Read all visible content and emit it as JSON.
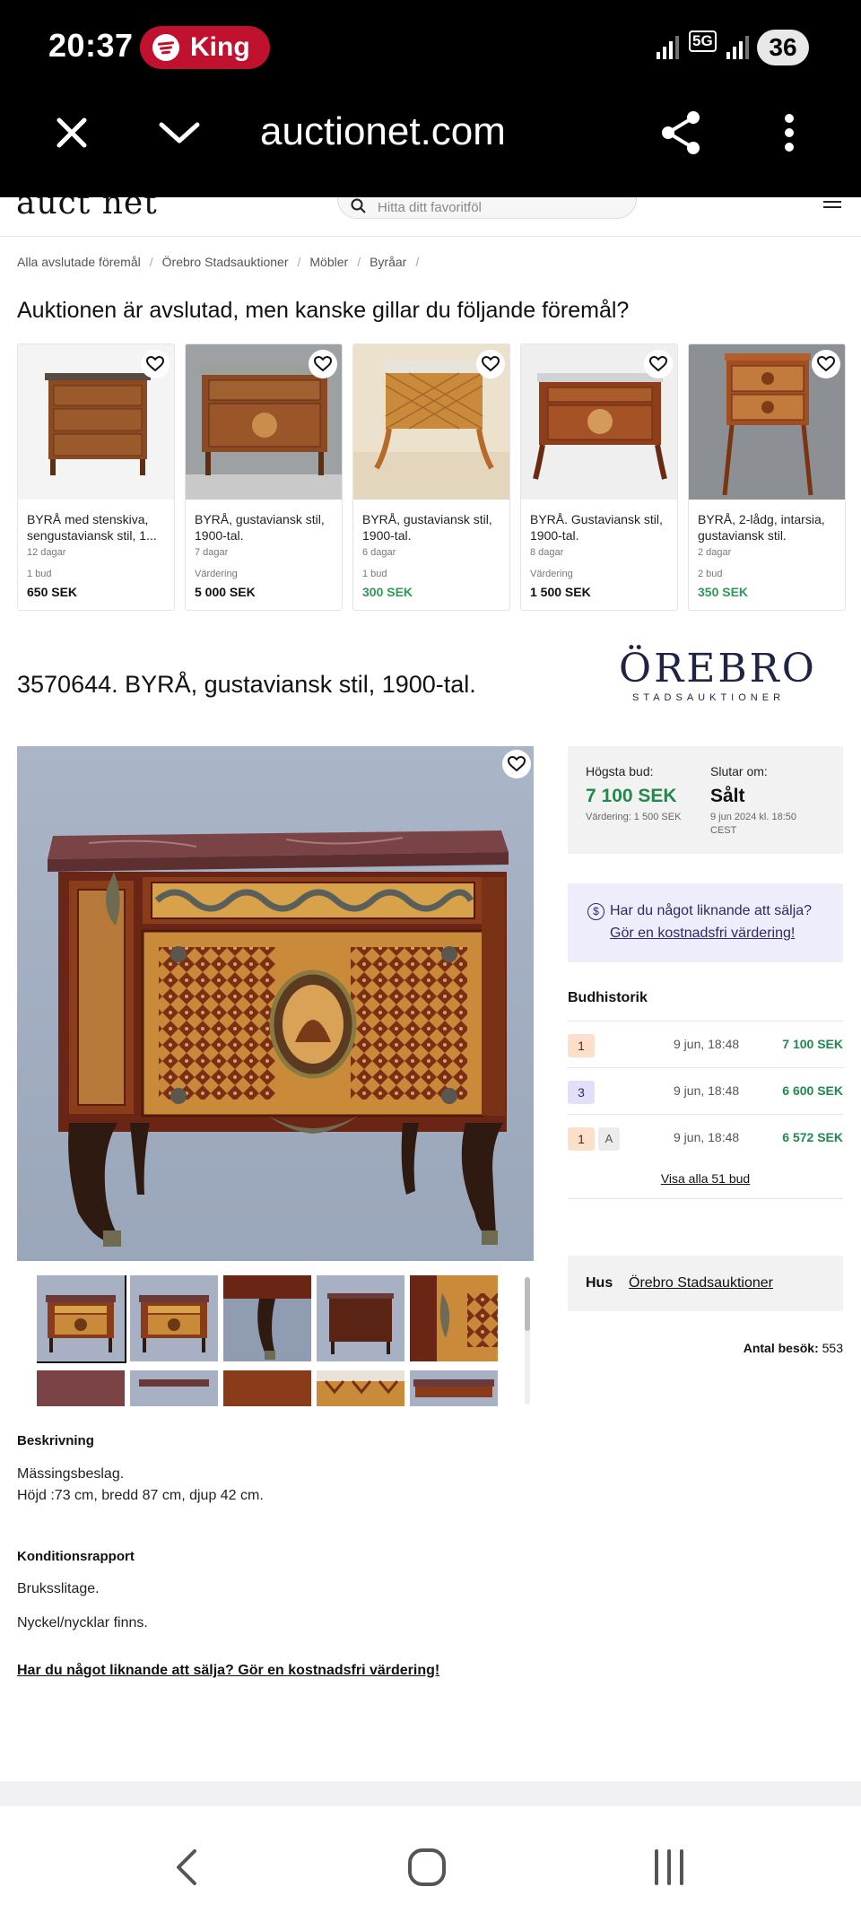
{
  "status": {
    "time": "20:37",
    "media_app": "King",
    "network": "5G",
    "battery": "36"
  },
  "browser": {
    "url": "auctionet.com",
    "icons": [
      "close-icon",
      "chevron-down-icon",
      "share-icon",
      "more-vertical-icon"
    ]
  },
  "site_header": {
    "logo": "auct  net",
    "search_placeholder": "Hitta ditt favoritföl"
  },
  "breadcrumb": [
    "Alla avslutade föremål",
    "Örebro Stadsauktioner",
    "Möbler",
    "Byråar"
  ],
  "recommendations": {
    "heading": "Auktionen är avslutad, men kanske gillar du följande föremål?",
    "items": [
      {
        "title": "BYRÅ med stenskiva, sengustaviansk stil, 1...",
        "time": "12 dagar",
        "meta": "1 bud",
        "price": "650 SEK",
        "price_color": "#111111"
      },
      {
        "title": "BYRÅ, gustaviansk stil, 1900-tal.",
        "time": "7 dagar",
        "meta": "Värdering",
        "price": "5 000 SEK",
        "price_color": "#111111"
      },
      {
        "title": "BYRÅ, gustaviansk stil, 1900-tal.",
        "time": "6 dagar",
        "meta": "1 bud",
        "price": "300 SEK",
        "price_color": "#2a9d55"
      },
      {
        "title": "BYRÅ. Gustaviansk stil, 1900-tal.",
        "time": "8 dagar",
        "meta": "Värdering",
        "price": "1 500 SEK",
        "price_color": "#111111"
      },
      {
        "title": "BYRÅ, 2-lådg, intarsia, gustaviansk stil.",
        "time": "2 dagar",
        "meta": "2 bud",
        "price": "350 SEK",
        "price_color": "#2a9d55"
      }
    ]
  },
  "lot": {
    "title": "3570644. BYRÅ, gustaviansk stil, 1900-tal.",
    "house_logo_main": "ÖREBRO",
    "house_logo_sub": "STADSAUKTIONER"
  },
  "bid_summary": {
    "highest_label": "Högsta bud:",
    "highest_value": "7 100 SEK",
    "valuation": "Värdering: 1 500 SEK",
    "ends_label": "Slutar om:",
    "ends_value": "Sålt",
    "ends_date": "9 jun 2024 kl. 18:50",
    "ends_tz": "CEST"
  },
  "valuation_cta": {
    "line1": "Har du något liknande att sälja?",
    "line2": "Gör en kostnadsfri värdering!"
  },
  "bid_history": {
    "title": "Budhistorik",
    "rows": [
      {
        "bidder": "1",
        "tag": "",
        "time": "9 jun, 18:48",
        "amount": "7 100 SEK"
      },
      {
        "bidder": "3",
        "tag": "",
        "time": "9 jun, 18:48",
        "amount": "6 600 SEK"
      },
      {
        "bidder": "1",
        "tag": "A",
        "time": "9 jun, 18:48",
        "amount": "6 572 SEK"
      }
    ],
    "show_all": "Visa alla 51 bud"
  },
  "house": {
    "label": "Hus",
    "name": "Örebro Stadsauktioner"
  },
  "visits": {
    "label": "Antal besök:",
    "value": "553"
  },
  "description": {
    "title": "Beskrivning",
    "line1": "Mässingsbeslag.",
    "line2": "Höjd :73 cm, bredd 87 cm, djup 42 cm."
  },
  "condition": {
    "title": "Konditionsrapport",
    "line1": "Bruksslitage.",
    "line2": "Nyckel/nycklar finns."
  },
  "bottom_cta": "Har du något liknande att sälja? Gör en kostnadsfri värdering!",
  "colors": {
    "green": "#1e8a4b",
    "navy": "#1f2345",
    "spotify_pill": "#c0112f"
  }
}
